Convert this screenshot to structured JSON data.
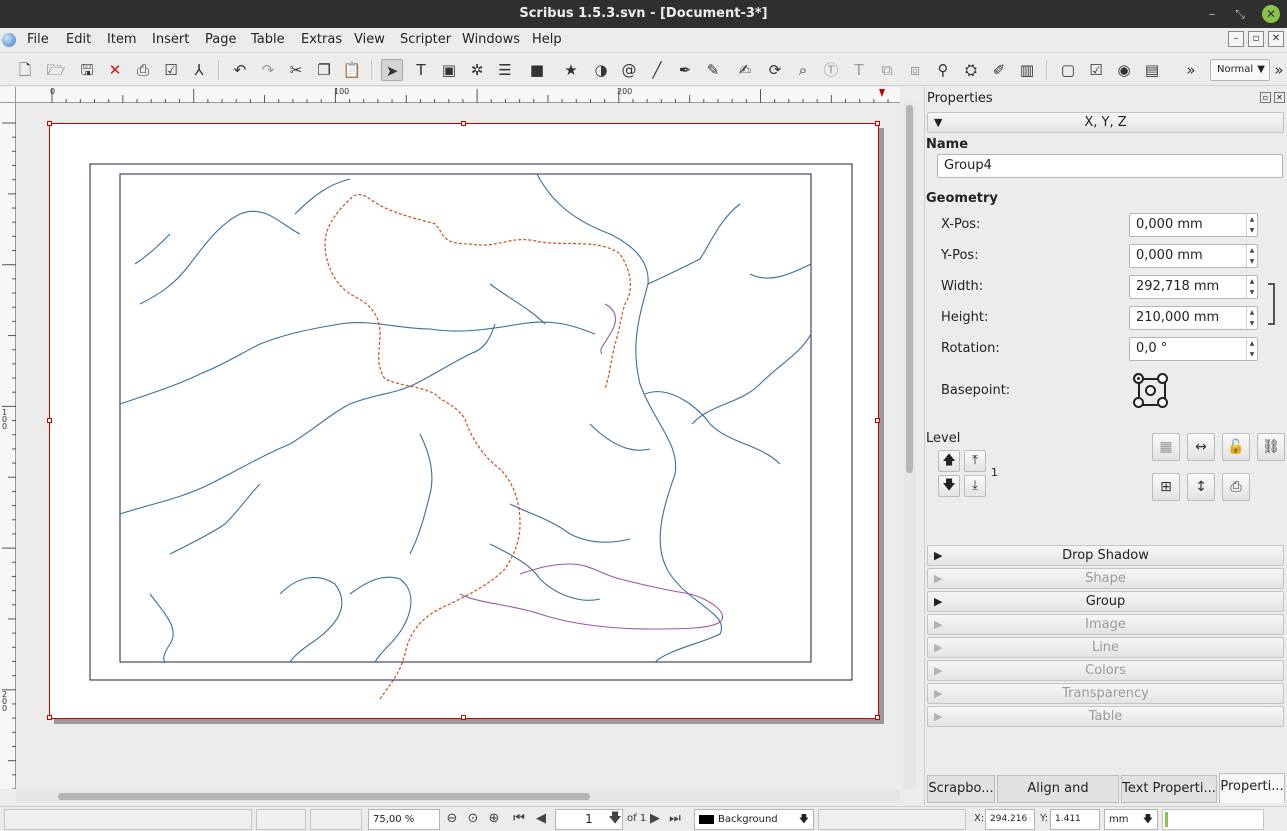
{
  "window": {
    "title": "Scribus 1.5.3.svn - [Document-3*]"
  },
  "menu": [
    "File",
    "Edit",
    "Item",
    "Insert",
    "Page",
    "Table",
    "Extras",
    "View",
    "Scripter",
    "Windows",
    "Help"
  ],
  "toolbar": {
    "mode": "Normal",
    "overflow": "»"
  },
  "ruler": {
    "h_ticks": [
      "0",
      "100",
      "200"
    ],
    "v_ticks": [
      "100",
      "200"
    ]
  },
  "properties": {
    "title": "Properties",
    "xyz_header": "X, Y, Z",
    "name_label": "Name",
    "name_value": "Group4",
    "geometry_label": "Geometry",
    "xpos_label": "X-Pos:",
    "xpos_value": "0,000 mm",
    "ypos_label": "Y-Pos:",
    "ypos_value": "0,000 mm",
    "width_label": "Width:",
    "width_value": "292,718 mm",
    "height_label": "Height:",
    "height_value": "210,000 mm",
    "rotation_label": "Rotation:",
    "rotation_value": "0,0 °",
    "basepoint_label": "Basepoint:",
    "level_label": "Level",
    "level_value": "1",
    "sections": [
      {
        "label": "Drop Shadow",
        "enabled": true
      },
      {
        "label": "Shape",
        "enabled": false
      },
      {
        "label": "Group",
        "enabled": true
      },
      {
        "label": "Image",
        "enabled": false
      },
      {
        "label": "Line",
        "enabled": false
      },
      {
        "label": "Colors",
        "enabled": false
      },
      {
        "label": "Transparency",
        "enabled": false
      },
      {
        "label": "Table",
        "enabled": false
      }
    ],
    "tabs": [
      "Scrapbo...",
      "Align and Distrib...",
      "Text Properti...",
      "Properti..."
    ]
  },
  "status": {
    "zoom": "75,00 %",
    "page": "1",
    "page_of": "of 1",
    "layer": "Background",
    "x_label": "X:",
    "x_value": "294.216",
    "y_label": "Y:",
    "y_value": "1.411",
    "unit": "mm"
  },
  "colors": {
    "water": "#3b6f97",
    "route_orange": "#c8501b",
    "route_purple": "#9a5aa6",
    "selection": "#cc0000"
  }
}
